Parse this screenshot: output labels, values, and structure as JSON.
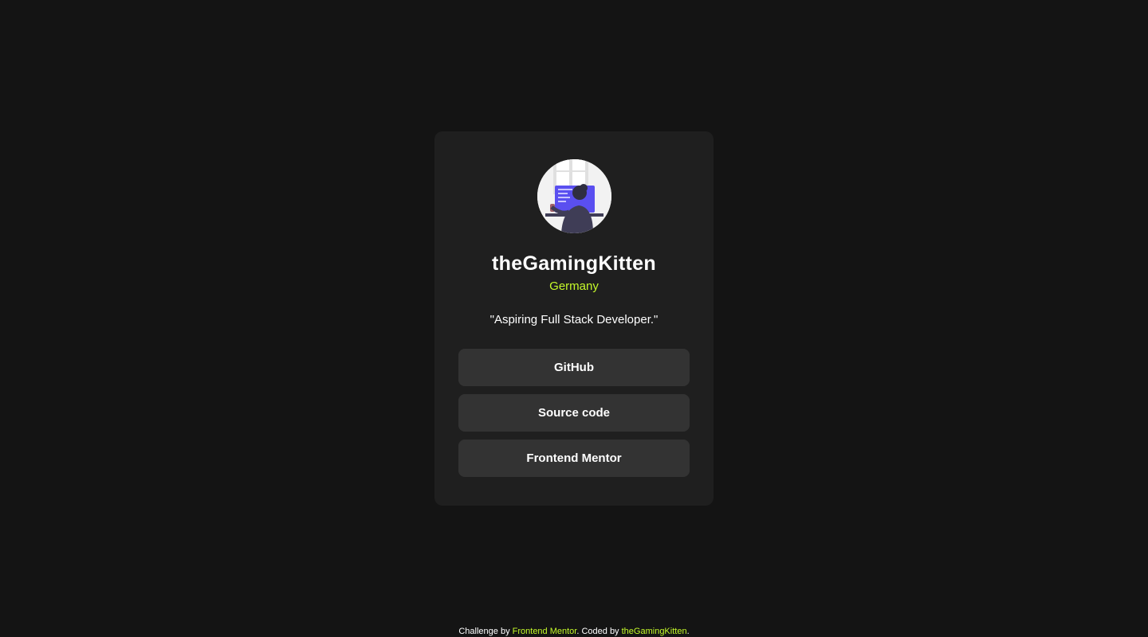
{
  "profile": {
    "name": "theGamingKitten",
    "location": "Germany",
    "bio": "\"Aspiring Full Stack Developer.\""
  },
  "links": [
    {
      "label": "GitHub"
    },
    {
      "label": "Source code"
    },
    {
      "label": "Frontend Mentor"
    }
  ],
  "footer": {
    "prefix": "Challenge by ",
    "challenge_link": "Frontend Mentor",
    "middle": ". Coded by ",
    "author_link": "theGamingKitten",
    "suffix": "."
  },
  "colors": {
    "background": "#141414",
    "card": "#1f1f1f",
    "button": "#333333",
    "accent": "#c4f82a"
  },
  "icons": {
    "avatar": "person-at-computer-illustration"
  }
}
